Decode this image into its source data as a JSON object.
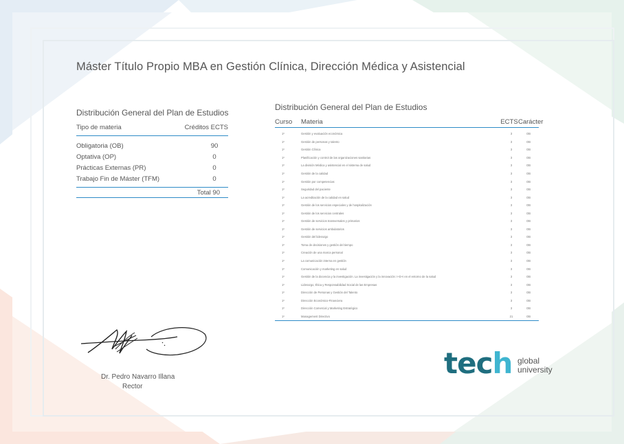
{
  "title": "Máster Título Propio MBA en Gestión Clínica, Dirección Médica y Asistencial",
  "summary": {
    "title": "Distribución General del Plan de Estudios",
    "headers": [
      "Tipo de materia",
      "Créditos ECTS"
    ],
    "rows": [
      {
        "label": "Obligatoria (OB)",
        "value": "90"
      },
      {
        "label": "Optativa (OP)",
        "value": "0"
      },
      {
        "label": "Prácticas Externas (PR)",
        "value": "0"
      },
      {
        "label": "Trabajo Fin de Máster (TFM)",
        "value": "0"
      }
    ],
    "total": "Total 90"
  },
  "courses": {
    "title": "Distribución General del Plan de Estudios",
    "headers": {
      "curso": "Curso",
      "materia": "Materia",
      "ects": "ECTS",
      "caracter": "Carácter"
    },
    "rows": [
      {
        "curso": "1º",
        "materia": "Gestión y evaluación económica",
        "ects": "3",
        "caracter": "OB"
      },
      {
        "curso": "1º",
        "materia": "Gestión de personas y talento",
        "ects": "3",
        "caracter": "OB"
      },
      {
        "curso": "1º",
        "materia": "Gestión Clínica",
        "ects": "3",
        "caracter": "OB"
      },
      {
        "curso": "1º",
        "materia": "Planificación y control de las organizaciones sanitarias",
        "ects": "3",
        "caracter": "OB"
      },
      {
        "curso": "1º",
        "materia": "La división Médica y asistencial en el sistema de salud",
        "ects": "3",
        "caracter": "OB"
      },
      {
        "curso": "1º",
        "materia": "Gestión de la calidad",
        "ects": "3",
        "caracter": "OB"
      },
      {
        "curso": "1º",
        "materia": "Gestión por competencias",
        "ects": "3",
        "caracter": "OB"
      },
      {
        "curso": "1º",
        "materia": "Seguridad del paciente",
        "ects": "3",
        "caracter": "OB"
      },
      {
        "curso": "1º",
        "materia": "La acreditación de la calidad en salud",
        "ects": "3",
        "caracter": "OB"
      },
      {
        "curso": "1º",
        "materia": "Gestión de los servicios especiales y de hospitalización",
        "ects": "3",
        "caracter": "OB"
      },
      {
        "curso": "1º",
        "materia": "Gestión de los servicios centrales",
        "ects": "3",
        "caracter": "OB"
      },
      {
        "curso": "1º",
        "materia": "Gestión de servicios transversales y primarios",
        "ects": "3",
        "caracter": "OB"
      },
      {
        "curso": "1º",
        "materia": "Gestión de servicios ambulatorios",
        "ects": "3",
        "caracter": "OB"
      },
      {
        "curso": "1º",
        "materia": "Gestión del liderazgo",
        "ects": "3",
        "caracter": "OB"
      },
      {
        "curso": "1º",
        "materia": "Toma de decisiones y gestión del tiempo",
        "ects": "3",
        "caracter": "OB"
      },
      {
        "curso": "1º",
        "materia": "Creación de una marca personal",
        "ects": "3",
        "caracter": "OB"
      },
      {
        "curso": "1º",
        "materia": "La comunicación interna en gestión",
        "ects": "3",
        "caracter": "OB"
      },
      {
        "curso": "1º",
        "materia": "Comunicación y marketing en salud",
        "ects": "3",
        "caracter": "OB"
      },
      {
        "curso": "1º",
        "materia": "Gestión de la docencia y la investigación. La investigación y la innovación: I+D+i en el entorno de la salud",
        "ects": "3",
        "caracter": "OB"
      },
      {
        "curso": "1º",
        "materia": "Liderazgo, Ética y Responsabilidad Social de las Empresas",
        "ects": "3",
        "caracter": "OB"
      },
      {
        "curso": "1º",
        "materia": "Dirección de Personas y Gestión del Talento",
        "ects": "3",
        "caracter": "OB"
      },
      {
        "curso": "1º",
        "materia": "Dirección Económico-Financiera",
        "ects": "3",
        "caracter": "OB"
      },
      {
        "curso": "1º",
        "materia": "Dirección Comercial y Marketing Estratégico",
        "ects": "3",
        "caracter": "OB"
      },
      {
        "curso": "1º",
        "materia": "Management Directivo",
        "ects": "21",
        "caracter": "OB"
      }
    ]
  },
  "signatory": {
    "name": "Dr. Pedro Navarro Illana",
    "role": "Rector"
  },
  "logo": {
    "brand_prefix": "tec",
    "brand_h": "h",
    "line1": "global",
    "line2": "university"
  },
  "colors": {
    "accent_line": "#2d8bc7",
    "logo_dark": "#1f6e7f",
    "logo_light": "#3fb5d0"
  }
}
